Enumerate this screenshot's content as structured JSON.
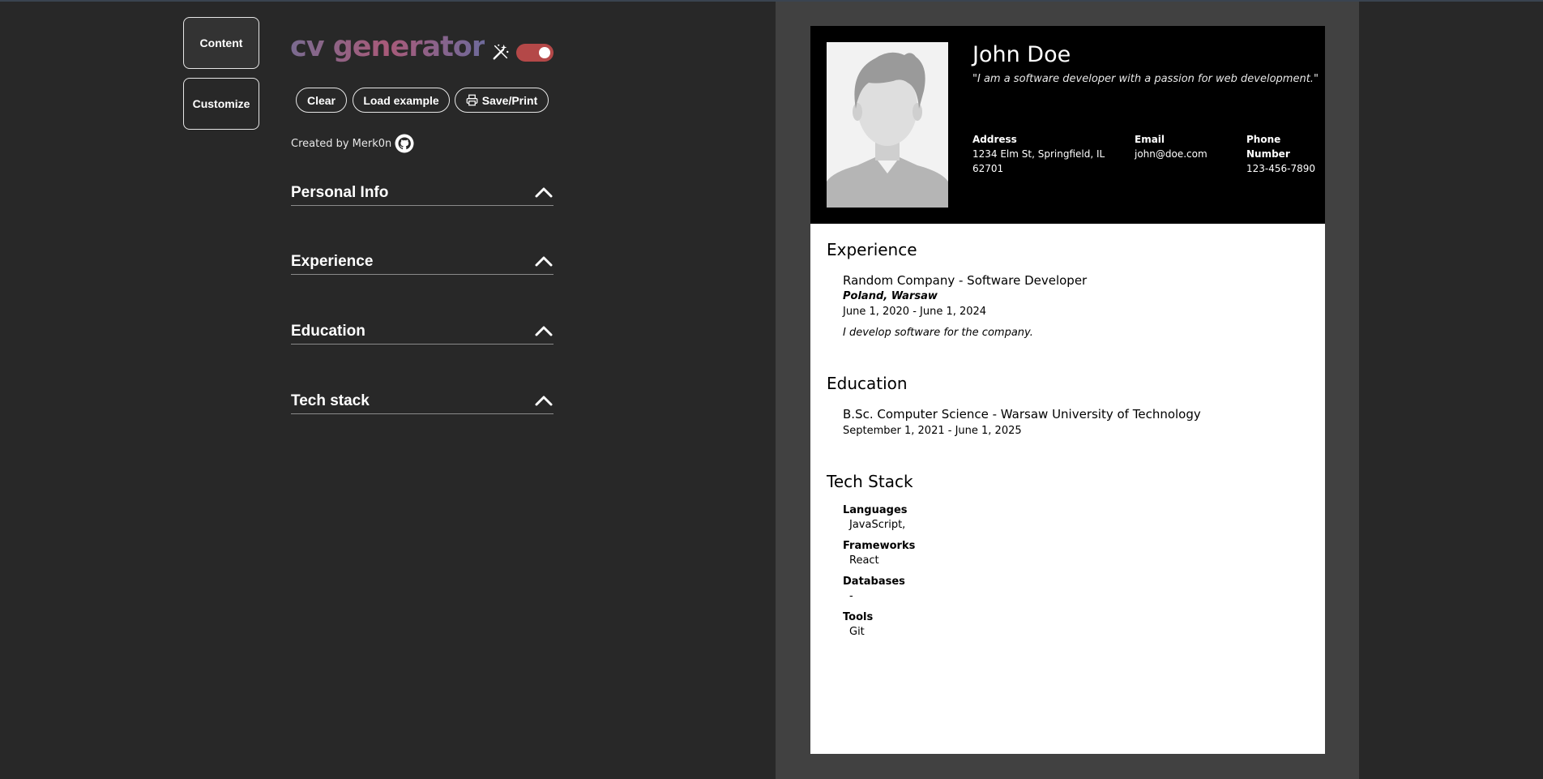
{
  "nav": {
    "content_label": "Content",
    "customize_label": "Customize"
  },
  "editor": {
    "app_title": "cv generator",
    "buttons": {
      "clear": "Clear",
      "load_example": "Load example",
      "save_print": "Save/Print"
    },
    "credit": "Created by Merk0n",
    "sections": [
      {
        "label": "Personal Info"
      },
      {
        "label": "Experience"
      },
      {
        "label": "Education"
      },
      {
        "label": "Tech stack"
      }
    ],
    "colors": {
      "toggle": "#b44848",
      "title_gradient": [
        "#7a6b90",
        "#a85a79",
        "#6e6a9a"
      ]
    },
    "icons": {
      "theme": "magic-wand-icon",
      "printer": "printer-icon",
      "github": "github-icon",
      "chevron": "chevron-up-icon"
    }
  },
  "cv": {
    "name": "John Doe",
    "quote": "\"I am a software developer with a passion for web development.\"",
    "address_label": "Address",
    "address": "1234 Elm St, Springfield, IL 62701",
    "email_label": "Email",
    "email": "john@doe.com",
    "phone_label": "Phone Number",
    "phone": "123-456-7890",
    "experience_heading": "Experience",
    "experience": [
      {
        "title": "Random Company - Software Developer",
        "location": "Poland, Warsaw",
        "dates": "June 1, 2020 - June 1, 2024",
        "description": "I develop software for the company."
      }
    ],
    "education_heading": "Education",
    "education": [
      {
        "title": "B.Sc. Computer Science - Warsaw University of Technology",
        "dates": "September 1, 2021 - June 1, 2025"
      }
    ],
    "tech_heading": "Tech Stack",
    "tech": [
      {
        "label": "Languages",
        "value": "JavaScript,"
      },
      {
        "label": "Frameworks",
        "value": "React"
      },
      {
        "label": "Databases",
        "value": "-"
      },
      {
        "label": "Tools",
        "value": "Git"
      }
    ]
  }
}
